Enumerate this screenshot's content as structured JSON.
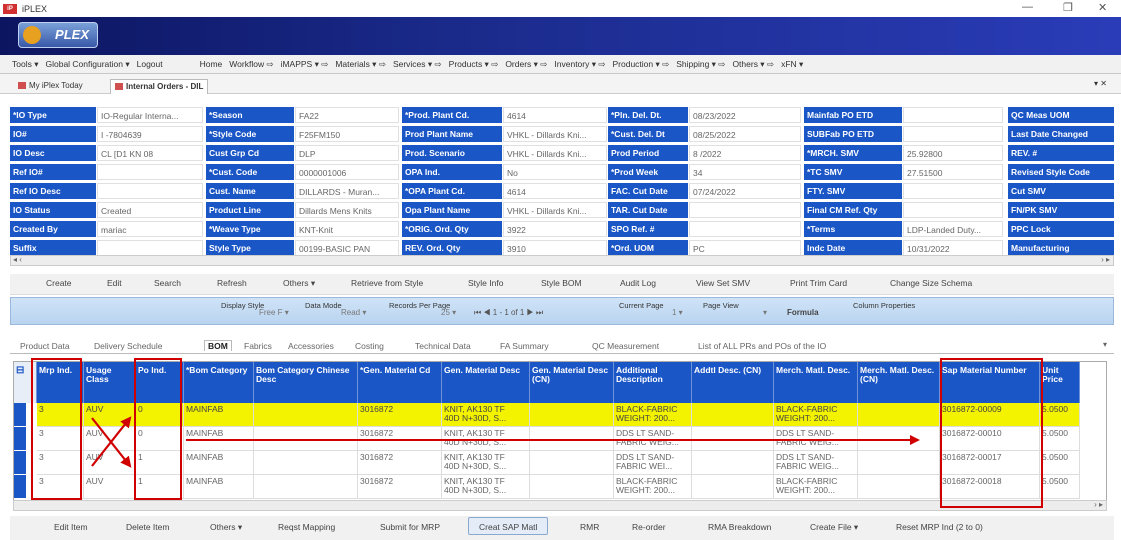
{
  "app": {
    "title": "iPLEX",
    "brand": "PLEX"
  },
  "window_controls": {
    "minimize": "—",
    "restore": "❐",
    "close": "✕"
  },
  "menu": [
    "Tools ▾",
    "Global Configuration ▾",
    "Logout",
    "Home",
    "Workflow ⇨",
    "iMAPPS ▾ ⇨",
    "Materials ▾ ⇨",
    "Services ▾ ⇨",
    "Products ▾ ⇨",
    "Orders ▾ ⇨",
    "Inventory ▾ ⇨",
    "Production ▾ ⇨",
    "Shipping ▾ ⇨",
    "Others ▾ ⇨",
    "xFN ▾"
  ],
  "tabs": [
    {
      "label": "My iPlex Today"
    },
    {
      "label": "Internal Orders - DIL"
    }
  ],
  "tab_close": "▾ ✕",
  "header_fields": [
    [
      {
        "label": "*IO Type",
        "value": "IO-Regular Interna..."
      },
      {
        "label": "*Season",
        "value": "FA22"
      },
      {
        "label": "*Prod. Plant Cd.",
        "value": "4614"
      },
      {
        "label": "*Pln. Del. Dt.",
        "value": "08/23/2022"
      },
      {
        "label": "Mainfab PO ETD",
        "value": ""
      },
      {
        "label": "QC Meas UOM",
        "value": ""
      }
    ],
    [
      {
        "label": "IO#",
        "value": "I -7804639"
      },
      {
        "label": "*Style Code",
        "value": "F25FM150"
      },
      {
        "label": "Prod Plant Name",
        "value": "VHKL - Dillards Kni..."
      },
      {
        "label": "*Cust. Del. Dt",
        "value": "08/25/2022"
      },
      {
        "label": "SUBFab PO ETD",
        "value": ""
      },
      {
        "label": "Last Date Changed",
        "value": ""
      }
    ],
    [
      {
        "label": "IO Desc",
        "value": "CL [D1 KN 08"
      },
      {
        "label": "Cust Grp Cd",
        "value": "DLP"
      },
      {
        "label": "Prod. Scenario",
        "value": "VHKL - Dillards Kni..."
      },
      {
        "label": "Prod Period",
        "value": "8 /2022"
      },
      {
        "label": "*MRCH. SMV",
        "value": "25.92800"
      },
      {
        "label": "REV. #",
        "value": ""
      }
    ],
    [
      {
        "label": "Ref IO#",
        "value": ""
      },
      {
        "label": "*Cust. Code",
        "value": "0000001006"
      },
      {
        "label": "OPA Ind.",
        "value": "No"
      },
      {
        "label": "*Prod Week",
        "value": "34"
      },
      {
        "label": "*TC SMV",
        "value": "27.51500"
      },
      {
        "label": "Revised Style Code",
        "value": ""
      }
    ],
    [
      {
        "label": "Ref IO Desc",
        "value": ""
      },
      {
        "label": "Cust. Name",
        "value": "DILLARDS - Muran..."
      },
      {
        "label": "*OPA Plant Cd.",
        "value": "4614"
      },
      {
        "label": "FAC. Cut Date",
        "value": "07/24/2022"
      },
      {
        "label": "FTY. SMV",
        "value": ""
      },
      {
        "label": "Cut SMV",
        "value": ""
      }
    ],
    [
      {
        "label": "IO Status",
        "value": "Created"
      },
      {
        "label": "Product Line",
        "value": "Dillards Mens Knits"
      },
      {
        "label": "Opa Plant Name",
        "value": "VHKL - Dillards Kni..."
      },
      {
        "label": "TAR. Cut Date",
        "value": ""
      },
      {
        "label": "Final CM Ref. Qty",
        "value": ""
      },
      {
        "label": "FN/PK SMV",
        "value": ""
      }
    ],
    [
      {
        "label": "Created By",
        "value": "mariac"
      },
      {
        "label": "*Weave Type",
        "value": "KNT-Knit"
      },
      {
        "label": "*ORIG. Ord. Qty",
        "value": "3922"
      },
      {
        "label": "SPO Ref. #",
        "value": ""
      },
      {
        "label": "*Terms",
        "value": "LDP-Landed Duty..."
      },
      {
        "label": "PPC Lock",
        "value": ""
      }
    ],
    [
      {
        "label": "Suffix",
        "value": ""
      },
      {
        "label": "Style Type",
        "value": "00199-BASIC PAN"
      },
      {
        "label": "REV. Ord. Qty",
        "value": "3910"
      },
      {
        "label": "*Ord. UOM",
        "value": "PC"
      },
      {
        "label": "Indc Date",
        "value": "10/31/2022"
      },
      {
        "label": "Manufacturing",
        "value": ""
      }
    ]
  ],
  "scroll": {
    "left": "◂ ‹",
    "right": "› ▸"
  },
  "toolbar1": [
    "Create",
    "Edit",
    "Search",
    "Refresh",
    "Others ▾",
    "Retrieve from Style",
    "Style Info",
    "Style BOM",
    "Audit Log",
    "View Set SMV",
    "Print Trim Card",
    "Change Size Schema"
  ],
  "pager": {
    "display_style_label": "Display Style",
    "display_style_value": "Free F ▾",
    "data_mode_label": "Data Mode",
    "data_mode_value": "Read ▾",
    "records_label": "Records Per Page",
    "records_value": "25 ▾",
    "nav": "⏮ ◀ 1 - 1 of 1 ▶ ⏭",
    "current_label": "Current Page",
    "current_value": "1 ▾",
    "page_view_label": "Page View",
    "page_view_value": "▾",
    "formula": "Formula",
    "column_props": "Column Properties"
  },
  "subtabs": [
    "Product Data",
    "Delivery Schedule",
    "BOM",
    "Fabrics",
    "Accessories",
    "Costing",
    "Technical Data",
    "FA Summary",
    "QC Measurement",
    "List of ALL PRs and POs of the IO"
  ],
  "bom": {
    "columns": [
      "Mrp Ind.",
      "Usage Class",
      "Po Ind.",
      "*Bom Category",
      "Bom Category Chinese Desc",
      "*Gen. Material Cd",
      "Gen. Material Desc",
      "Gen. Material Desc (CN)",
      "Additional Description",
      "Addtl Desc. (CN)",
      "Merch. Matl. Desc.",
      "Merch. Matl. Desc. (CN)",
      "Sap Material Number",
      "Unit Price"
    ],
    "rows": [
      [
        "3",
        "AUV",
        "0",
        "MAINFAB",
        "",
        "3016872",
        "KNIT, AK130 TF\n40D N+30D, S...",
        "",
        "BLACK-FABRIC\nWEIGHT: 200...",
        "",
        "BLACK-FABRIC\nWEIGHT: 200...",
        "",
        "3016872-00009",
        "5.0500"
      ],
      [
        "3",
        "AUV",
        "0",
        "MAINFAB",
        "",
        "3016872",
        "KNIT, AK130 TF\n40D N+30D, S...",
        "",
        "DDS LT SAND-\nFABRIC WEIG...",
        "",
        "DDS LT SAND-\nFABRIC WEIG...",
        "",
        "3016872-00010",
        "5.0500"
      ],
      [
        "3",
        "AUV",
        "1",
        "MAINFAB",
        "",
        "3016872",
        "KNIT, AK130 TF\n40D N+30D, S...",
        "",
        "DDS LT SAND-\nFABRIC WEI...",
        "",
        "DDS LT SAND-\nFABRIC WEIG...",
        "",
        "3016872-00017",
        "5.0500"
      ],
      [
        "3",
        "AUV",
        "1",
        "MAINFAB",
        "",
        "3016872",
        "KNIT, AK130 TF\n40D N+30D, S...",
        "",
        "BLACK-FABRIC\nWEIGHT: 200...",
        "",
        "BLACK-FABRIC\nWEIGHT: 200...",
        "",
        "3016872-00018",
        "5.0500"
      ]
    ]
  },
  "toolbar2": [
    "Edit Item",
    "Delete Item",
    "Others ▾",
    "Reqst Mapping",
    "Submit for MRP",
    "Creat SAP Matl",
    "RMR",
    "Re-order",
    "RMA Breakdown",
    "Create File ▾",
    "Reset MRP Ind (2 to 0)"
  ],
  "colors": {
    "accent": "#1b56c6",
    "highlight_row": "#f3f300",
    "annotation": "#d00000"
  }
}
